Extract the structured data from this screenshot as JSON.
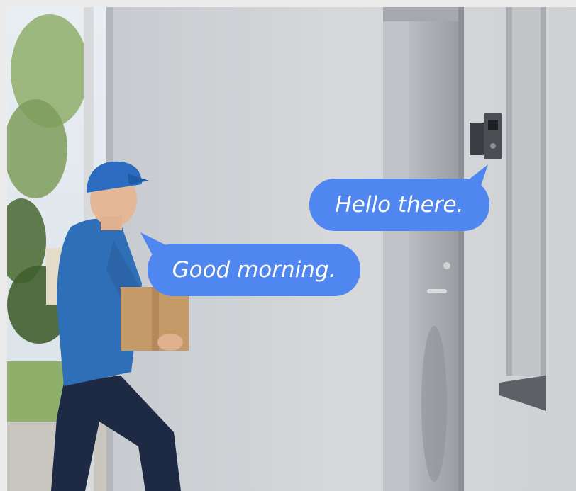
{
  "scene": {
    "description_free": true,
    "colors": {
      "bubble": "#4f86f0",
      "bubble_text": "#ffffff",
      "wall": "#d5d7da",
      "uniform": "#2e6fb8",
      "pants": "#1e2a44",
      "box": "#c49a68"
    }
  },
  "bubbles": {
    "doorbell_text": "Hello there.",
    "courier_text": "Good morning."
  }
}
